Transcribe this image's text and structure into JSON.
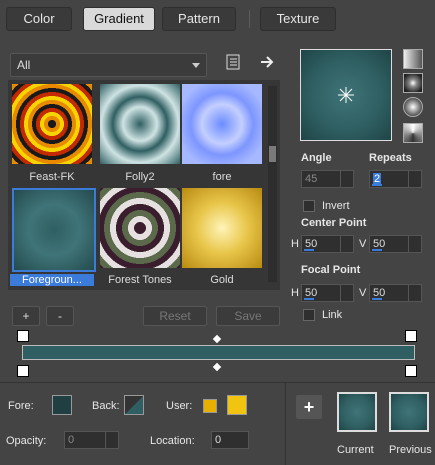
{
  "tabs": [
    {
      "label": "Color"
    },
    {
      "label": "Gradient",
      "active": true
    },
    {
      "label": "Pattern"
    },
    {
      "label": "Texture"
    }
  ],
  "filter": {
    "value": "All"
  },
  "thumbnails": [
    {
      "label": "Feast-FK"
    },
    {
      "label": "Folly2"
    },
    {
      "label": "fore"
    },
    {
      "label": "Foregroun..."
    },
    {
      "label": "Forest Tones"
    },
    {
      "label": "Gold"
    }
  ],
  "buttons": {
    "add": "+",
    "remove": "-",
    "reset": "Reset",
    "save": "Save"
  },
  "angle": {
    "label": "Angle",
    "value": "45"
  },
  "repeats": {
    "label": "Repeats",
    "value": "2"
  },
  "invert": {
    "label": "Invert"
  },
  "center_point": {
    "label": "Center Point",
    "h_label": "H",
    "h": "50",
    "v_label": "V",
    "v": "50"
  },
  "focal_point": {
    "label": "Focal Point",
    "h_label": "H",
    "h": "50",
    "v_label": "V",
    "v": "50"
  },
  "link": {
    "label": "Link"
  },
  "bottom": {
    "fore_label": "Fore:",
    "back_label": "Back:",
    "user_label": "User:",
    "opacity_label": "Opacity:",
    "opacity_value": "0",
    "location_label": "Location:",
    "location_value": "0",
    "current_label": "Current",
    "previous_label": "Previous",
    "add_button": "+"
  },
  "colors": {
    "teal": "#2f5f62",
    "user_yellow": "#e8b000",
    "accent": "#3b7bd9"
  }
}
